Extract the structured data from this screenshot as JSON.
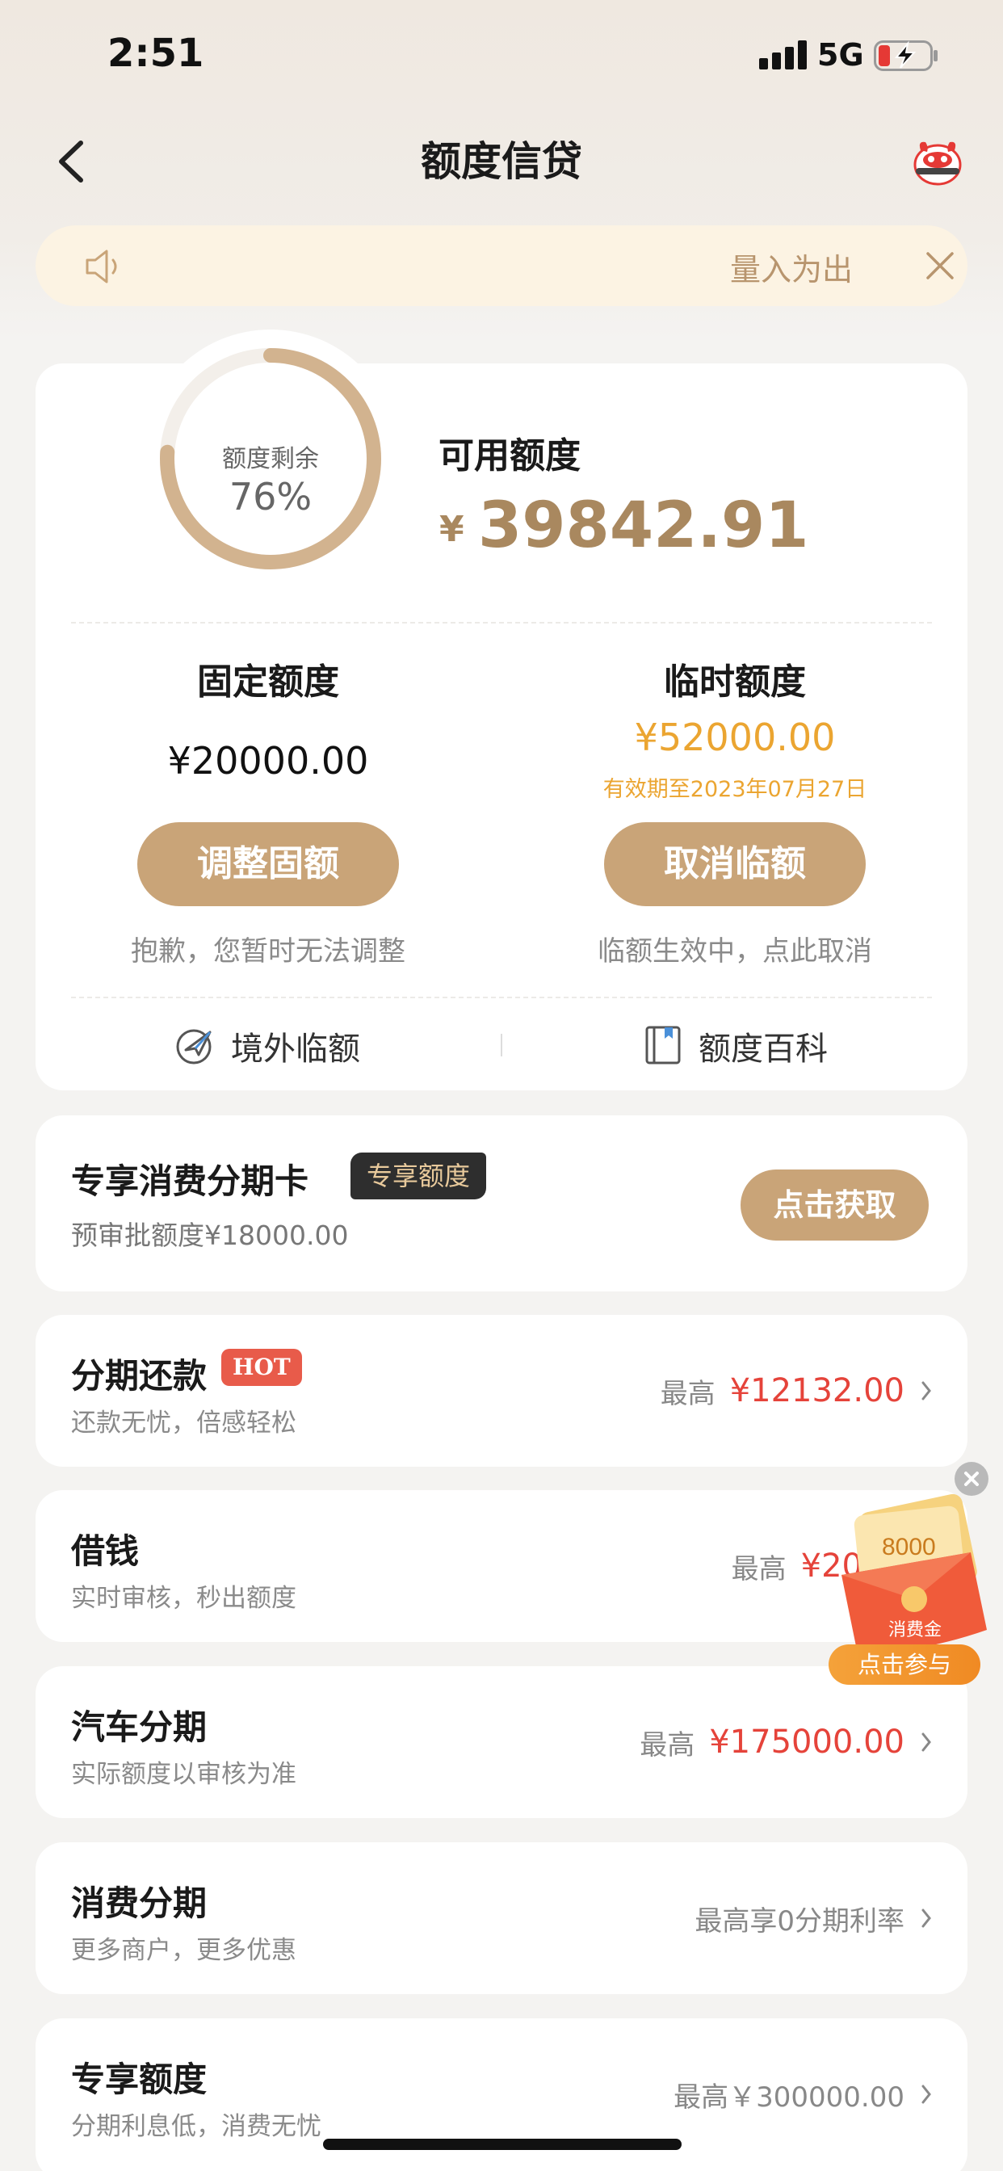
{
  "status_bar": {
    "time": "2:51",
    "network": "5G"
  },
  "nav": {
    "title": "额度信贷"
  },
  "notice": {
    "text": "量入为出"
  },
  "quota": {
    "ring_label": "额度剩余",
    "ring_percent": "76%",
    "ring_fraction": 0.76,
    "available_label": "可用额度",
    "available_currency": "¥",
    "available_amount": "39842.91",
    "fixed_label": "固定额度",
    "fixed_amount": "¥20000.00",
    "temp_label": "临时额度",
    "temp_amount": "¥52000.00",
    "temp_valid": "有效期至2023年07月27日",
    "adjust_button": "调整固额",
    "cancel_button": "取消临额",
    "adjust_hint": "抱歉，您暂时无法调整",
    "cancel_hint": "临额生效中，点此取消",
    "overseas_link": "境外临额",
    "encyclopedia_link": "额度百科"
  },
  "exclusive_card": {
    "title": "专享消费分期卡",
    "tag": "专享额度",
    "subtitle": "预审批额度¥18000.00",
    "button": "点击获取"
  },
  "items": [
    {
      "title": "分期还款",
      "badge": "HOT",
      "subtitle": "还款无忧，倍感轻松",
      "prefix": "最高",
      "value": "¥12132.00"
    },
    {
      "title": "借钱",
      "subtitle": "实时审核，秒出额度",
      "prefix": "最高",
      "value": "¥20"
    },
    {
      "title": "汽车分期",
      "subtitle": "实际额度以审核为准",
      "prefix": "最高",
      "value": "¥175000.00"
    },
    {
      "title": "消费分期",
      "subtitle": "更多商户，更多优惠",
      "text": "最高享0分期利率"
    },
    {
      "title": "专享额度",
      "subtitle": "分期利息低，消费无忧",
      "text": "最高￥300000.00"
    }
  ],
  "promo": {
    "amount": "8000",
    "label": "消费金",
    "button": "点击参与"
  },
  "colors": {
    "gold": "#c9a478",
    "gold_text": "#a9885f",
    "orange": "#eba531",
    "red": "#e5433a"
  }
}
